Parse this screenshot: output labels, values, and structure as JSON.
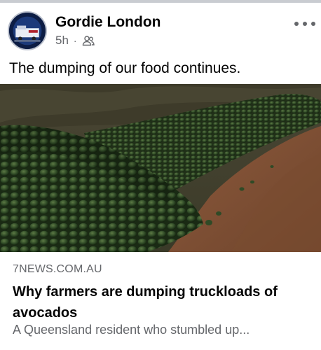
{
  "post": {
    "author": "Gordie London",
    "time": "5h",
    "separator": "·",
    "audience_icon": "group-icon",
    "more_icon": "more-options-icon",
    "caption": "The dumping of our food continues."
  },
  "link_preview": {
    "image_subject": "avocado-pile-photo",
    "domain": "7NEWS.COM.AU",
    "headline": "Why farmers are dumping truckloads of avocados",
    "description": "A Queensland resident who stumbled up..."
  },
  "colors": {
    "secondary_text": "#65676b",
    "primary_text": "#050505",
    "divider": "#c9ccd1"
  }
}
